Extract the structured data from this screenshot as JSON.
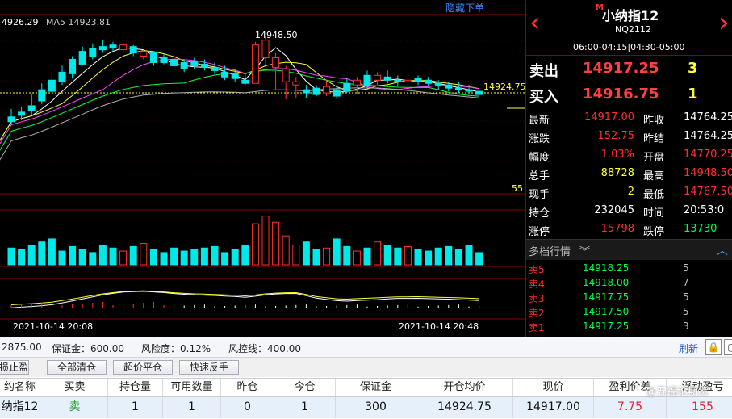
{
  "chart": {
    "hide_toggle": "隐藏下单",
    "ma_value_left": "4926.29",
    "ma_label": "MA5 14923.81",
    "high_label": "14948.50",
    "current_label": "14924.75",
    "indicator_tick": "55",
    "time_start": "2021-10-14 20:08",
    "time_end": "2021-10-14 20:48",
    "colors": {
      "up": "#ff3030",
      "down": "#00e8e8",
      "ma1": "#ffffff",
      "ma2": "#ffff33",
      "ma3": "#ff44ff",
      "ma4": "#00ff40",
      "ma5": "#b0b0b0"
    }
  },
  "chart_data": {
    "type": "candlestick",
    "title": "",
    "ylim": [
      14855,
      14960
    ],
    "candles": [
      [
        14898,
        14903,
        14893,
        14895
      ],
      [
        14901,
        14904,
        14896,
        14899
      ],
      [
        14905,
        14912,
        14899,
        14902
      ],
      [
        14915,
        14919,
        14906,
        14908
      ],
      [
        14921,
        14925,
        14912,
        14914
      ],
      [
        14926,
        14930,
        14918,
        14920
      ],
      [
        14934,
        14936,
        14922,
        14925
      ],
      [
        14939,
        14942,
        14930,
        14931
      ],
      [
        14941,
        14944,
        14934,
        14936
      ],
      [
        14942,
        14946,
        14938,
        14940
      ],
      [
        14943,
        14945,
        14939,
        14941
      ],
      [
        14940,
        14945,
        14937,
        14943
      ],
      [
        14942,
        14943,
        14936,
        14938
      ],
      [
        14936,
        14940,
        14934,
        14939
      ],
      [
        14938,
        14939,
        14930,
        14932
      ],
      [
        14935,
        14937,
        14931,
        14932
      ],
      [
        14934,
        14937,
        14929,
        14930
      ],
      [
        14932,
        14934,
        14926,
        14928
      ],
      [
        14933,
        14935,
        14928,
        14930
      ],
      [
        14931,
        14934,
        14927,
        14929
      ],
      [
        14929,
        14932,
        14925,
        14927
      ],
      [
        14926,
        14930,
        14921,
        14923
      ],
      [
        14925,
        14928,
        14920,
        14922
      ],
      [
        14921,
        14925,
        14918,
        14919
      ],
      [
        14919,
        14945,
        14919,
        14943
      ],
      [
        14935,
        14948,
        14930,
        14946
      ],
      [
        14929,
        14938,
        14915,
        14935
      ],
      [
        14920,
        14930,
        14909,
        14928
      ],
      [
        14918,
        14923,
        14910,
        14920
      ],
      [
        14915,
        14918,
        14910,
        14913
      ],
      [
        14916,
        14918,
        14911,
        14912
      ],
      [
        14913,
        14921,
        14911,
        14917
      ],
      [
        14915,
        14918,
        14909,
        14911
      ],
      [
        14919,
        14922,
        14913,
        14914
      ],
      [
        14918,
        14923,
        14912,
        14921
      ],
      [
        14924,
        14927,
        14916,
        14918
      ],
      [
        14921,
        14926,
        14918,
        14924
      ],
      [
        14923,
        14927,
        14919,
        14921
      ],
      [
        14921,
        14924,
        14917,
        14920
      ],
      [
        14920,
        14923,
        14917,
        14921
      ],
      [
        14922,
        14924,
        14918,
        14920
      ],
      [
        14921,
        14923,
        14917,
        14919
      ],
      [
        14919,
        14921,
        14915,
        14918
      ],
      [
        14918,
        14920,
        14914,
        14916
      ],
      [
        14916,
        14920,
        14913,
        14915
      ],
      [
        14915,
        14918,
        14913,
        14914
      ],
      [
        14914,
        14916,
        14911,
        14912
      ]
    ],
    "volume": [
      22,
      20,
      26,
      30,
      34,
      18,
      24,
      20,
      16,
      26,
      22,
      18,
      24,
      28,
      20,
      16,
      22,
      18,
      20,
      22,
      24,
      16,
      20,
      26,
      54,
      64,
      56,
      38,
      26,
      30,
      20,
      22,
      34,
      24,
      18,
      22,
      30,
      26,
      22,
      24,
      20,
      18,
      22,
      24,
      20,
      26,
      16
    ]
  },
  "quote": {
    "marker": "M",
    "name": "小纳指12",
    "code": "NQ2112",
    "hours": "06:00-04:15|04:30-05:00",
    "sell_label": "卖出",
    "sell_price": "14917.25",
    "sell_qty": "3",
    "buy_label": "买入",
    "buy_price": "14916.75",
    "buy_qty": "1",
    "rows": [
      {
        "l1": "最新",
        "v1": "14917.00",
        "c1": "red",
        "l2": "昨收",
        "v2": "14764.25",
        "c2": "wht"
      },
      {
        "l1": "涨跌",
        "v1": "152.75",
        "c1": "red",
        "l2": "昨结",
        "v2": "14764.25",
        "c2": "wht"
      },
      {
        "l1": "幅度",
        "v1": "1.03%",
        "c1": "red",
        "l2": "开盘",
        "v2": "14770.25",
        "c2": "red"
      },
      {
        "l1": "总手",
        "v1": "88728",
        "c1": "yel",
        "l2": "最高",
        "v2": "14948.50",
        "c2": "red"
      },
      {
        "l1": "现手",
        "v1": "2",
        "c1": "yel",
        "l2": "最低",
        "v2": "14767.50",
        "c2": "red"
      },
      {
        "l1": "持仓",
        "v1": "232045",
        "c1": "wht",
        "l2": "时间",
        "v2": "20:53:0",
        "c2": "wht"
      },
      {
        "l1": "涨停",
        "v1": "15798",
        "c1": "red",
        "l2": "跌停",
        "v2": "13730",
        "c2": "grn"
      }
    ],
    "depth_title": "多档行情",
    "depth": [
      {
        "label": "卖5",
        "price": "14918.25",
        "qty": "5"
      },
      {
        "label": "卖4",
        "price": "14918.00",
        "qty": "7"
      },
      {
        "label": "卖3",
        "price": "14917.75",
        "qty": "5"
      },
      {
        "label": "卖2",
        "price": "14917.50",
        "qty": "5"
      },
      {
        "label": "卖1",
        "price": "14917.25",
        "qty": "3"
      }
    ]
  },
  "status": {
    "balance": "2875.00",
    "margin": "保证金：600.00",
    "risk": "风险度：0.12%",
    "control": "风控线：400.00",
    "refresh": "刷新"
  },
  "buttons": {
    "stop": "损止盈",
    "close_all": "全部清仓",
    "fast_close": "超价平仓",
    "reverse": "快速反手"
  },
  "table": {
    "headers": [
      "约名称",
      "买卖",
      "持仓量",
      "可用数量",
      "昨仓",
      "今仓",
      "保证金",
      "开仓均价",
      "现价",
      "盈利价差",
      "浮动盈亏"
    ],
    "row": [
      "纳指12",
      "卖",
      "1",
      "1",
      "0",
      "1",
      "300",
      "14924.75",
      "14917.00",
      "7.75",
      "155"
    ]
  },
  "watermark": "@五福论期货"
}
